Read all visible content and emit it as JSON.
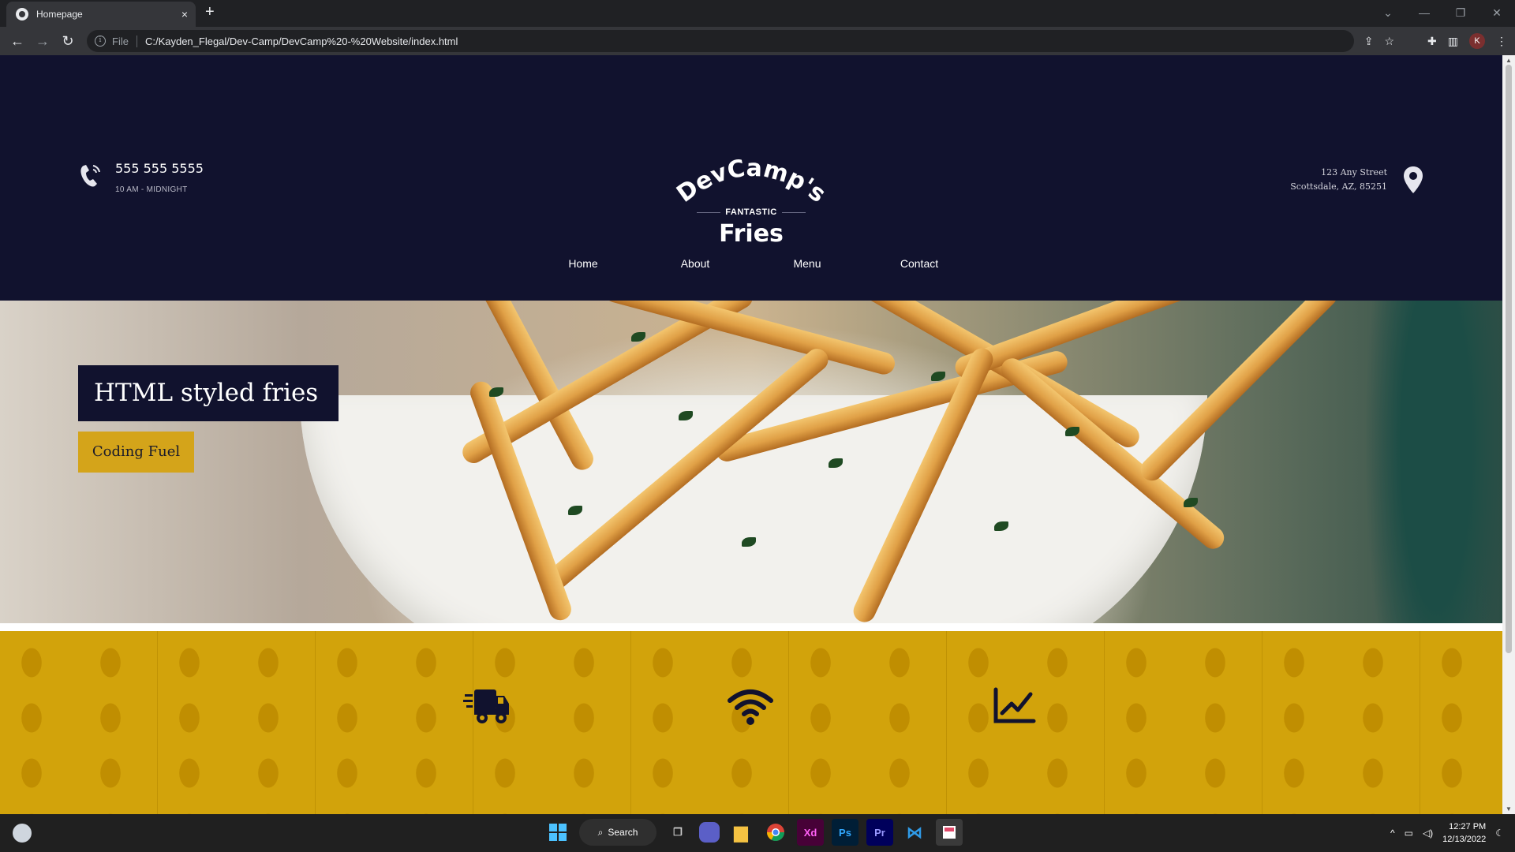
{
  "browser": {
    "tab_title": "Homepage",
    "tab_close": "×",
    "new_tab": "+",
    "omnibox_scheme": "File",
    "omnibox_url": "C:/Kayden_Flegal/Dev-Camp/DevCamp%20-%20Website/index.html",
    "profile_initial": "K",
    "window_controls": [
      "⌄",
      "—",
      "❐",
      "✕"
    ]
  },
  "header": {
    "phone_number": "555 555 5555",
    "phone_hours": "10 AM - MIDNIGHT",
    "logo_arc_text": "DevCamp's",
    "logo_fantastic": "FANTASTIC",
    "logo_fries": "Fries",
    "address_line1": "123 Any Street",
    "address_line2": "Scottsdale, AZ, 85251"
  },
  "nav": {
    "items": [
      "Home",
      "About",
      "Menu",
      "Contact"
    ]
  },
  "hero": {
    "title": "HTML styled fries",
    "button": "Coding Fuel"
  },
  "features": {
    "icons": [
      "delivery-truck-icon",
      "wifi-icon",
      "chart-line-icon"
    ]
  },
  "taskbar": {
    "search_label": "Search",
    "apps": [
      "Xd",
      "Ps",
      "Pr"
    ],
    "time": "12:27 PM",
    "date": "12/13/2022"
  },
  "colors": {
    "navy": "#11122e",
    "gold": "#d4a41a",
    "feature_bg": "#d2a30b"
  }
}
